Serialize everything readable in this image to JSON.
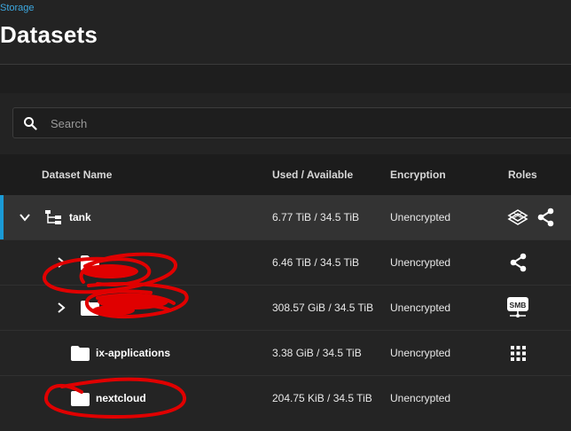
{
  "header": {
    "breadcrumb": "Storage",
    "title": "Datasets"
  },
  "search": {
    "placeholder": "Search",
    "value": ""
  },
  "table": {
    "columns": [
      "Dataset Name",
      "Used / Available",
      "Encryption",
      "Roles"
    ],
    "rows": [
      {
        "name": "tank",
        "used": "6.77 TiB / 34.5 TiB",
        "encryption": "Unencrypted",
        "roles": [
          "apps-icon",
          "share-icon"
        ]
      },
      {
        "name": "",
        "used": "6.46 TiB / 34.5 TiB",
        "encryption": "Unencrypted",
        "roles": [
          "share-icon"
        ]
      },
      {
        "name": "",
        "used": "308.57 GiB / 34.5 TiB",
        "encryption": "Unencrypted",
        "roles": [
          "smb-share-icon"
        ],
        "role_label": "SMB"
      },
      {
        "name": "ix-applications",
        "used": "3.38 GiB / 34.5 TiB",
        "encryption": "Unencrypted",
        "roles": [
          "apps-grid-icon"
        ]
      },
      {
        "name": "nextcloud",
        "used": "204.75 KiB / 34.5 TiB",
        "encryption": "Unencrypted",
        "roles": []
      }
    ]
  },
  "colors": {
    "accent": "#1a9ad6",
    "breadcrumb": "#3da8e0",
    "annotation": "#e00000"
  }
}
